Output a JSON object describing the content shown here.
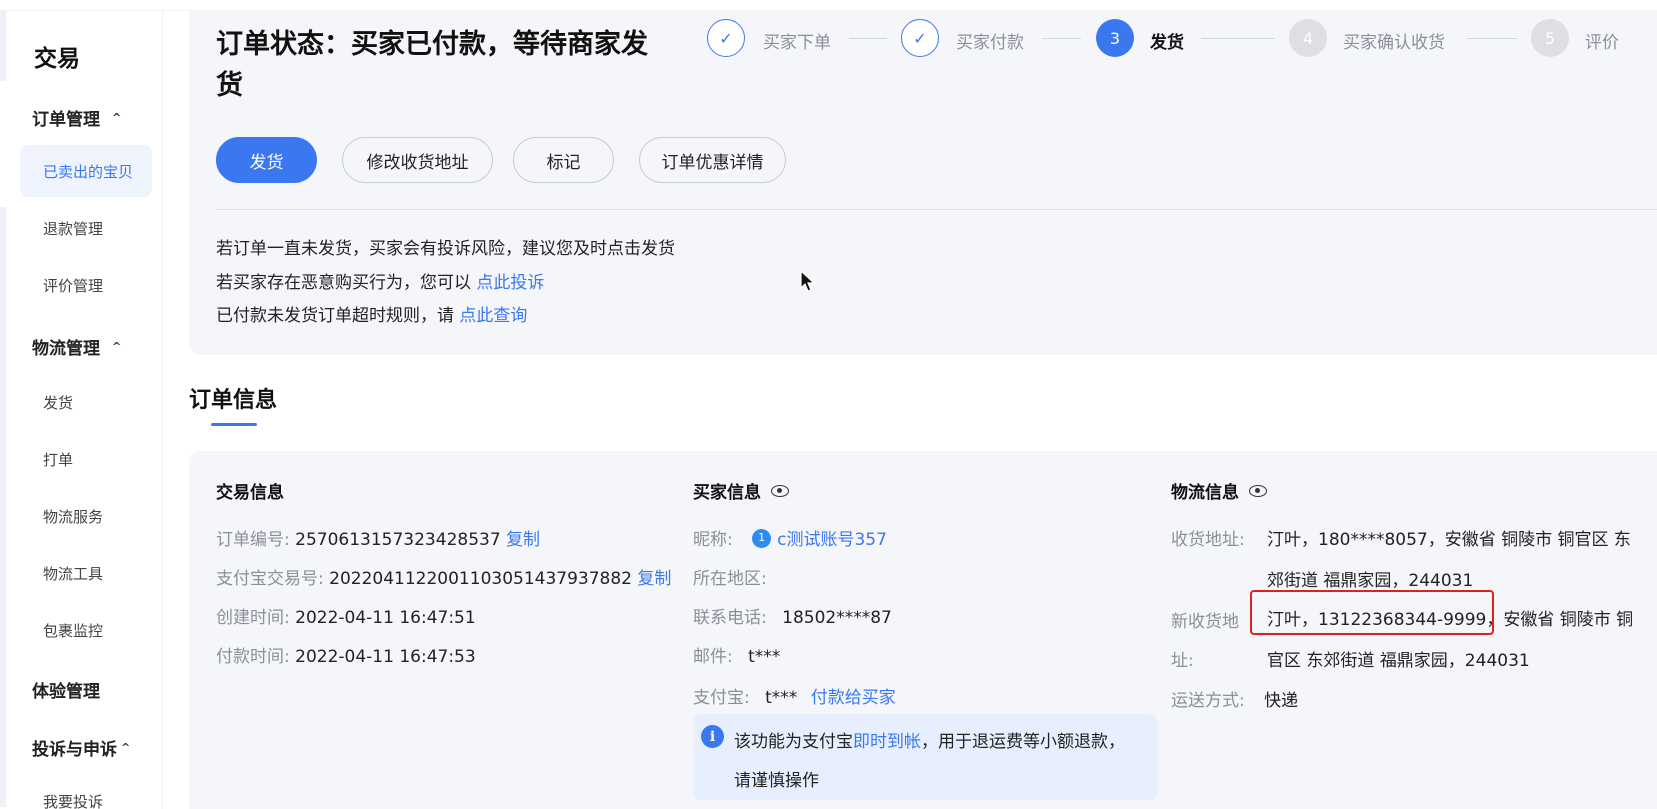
{
  "sidebar": {
    "title": "交易",
    "groups": {
      "order_mgmt": "订单管理",
      "logistics_mgmt": "物流管理",
      "experience_mgmt": "体验管理",
      "complaint": "投诉与申诉"
    },
    "items": {
      "sold_items": "已卖出的宝贝",
      "refund_mgmt": "退款管理",
      "review_mgmt": "评价管理",
      "ship": "发货",
      "print": "打单",
      "logistics_service": "物流服务",
      "logistics_tools": "物流工具",
      "package_monitor": "包裹监控",
      "my_complaint": "我要投诉"
    },
    "chevron": "^"
  },
  "status": {
    "title": "订单状态：买家已付款，等待商家发货",
    "steps": [
      {
        "mark": "✓",
        "label": "买家下单",
        "state": "done"
      },
      {
        "mark": "✓",
        "label": "买家付款",
        "state": "done"
      },
      {
        "mark": "3",
        "label": "发货",
        "state": "current"
      },
      {
        "mark": "4",
        "label": "买家确认收货",
        "state": "todo"
      },
      {
        "mark": "5",
        "label": "评价",
        "state": "todo"
      }
    ],
    "buttons": {
      "ship": "发货",
      "edit_address": "修改收货地址",
      "mark": "标记",
      "discount_detail": "订单优惠详情"
    },
    "notices": {
      "line1": "若订单一直未发货，买家会有投诉风险，建议您及时点击发货",
      "line2_prefix": "若买家存在恶意购买行为，您可以 ",
      "line2_link": "点此投诉",
      "line3_prefix": "已付款未发货订单超时规则，请 ",
      "line3_link": "点此查询"
    }
  },
  "order_info": {
    "section_title": "订单信息",
    "trade": {
      "title": "交易信息",
      "order_no_label": "订单编号: ",
      "order_no": "2570613157323428537",
      "copy": "复制",
      "alipay_no_label": "支付宝交易号: ",
      "alipay_no": "2022041122001103051437937882",
      "created_label": "创建时间: ",
      "created": "2022-04-11 16:47:51",
      "paid_label": "付款时间: ",
      "paid": "2022-04-11 16:47:53"
    },
    "buyer": {
      "title": "买家信息",
      "nickname_label": "昵称:",
      "nickname": "c测试账号357",
      "region_label": "所在地区:",
      "phone_label": "联系电话:",
      "phone": "18502****87",
      "email_label": "邮件:",
      "email": "t***",
      "alipay_label": "支付宝:",
      "alipay": "t***",
      "pay_buyer_link": "付款给买家",
      "tip_prefix": "该功能为支付宝",
      "tip_link": "即时到帐",
      "tip_suffix": "，用于退运费等小额退款，",
      "tip_line2": "请谨慎操作"
    },
    "logistics": {
      "title": "物流信息",
      "address_label": "收货地址:",
      "address_line1": "汀叶，180****8057，安徽省 铜陵市 铜官区 东",
      "address_line2": "郊街道 福鼎家园，244031",
      "new_address_label_1": "新收货地",
      "new_address_label_2": "址:",
      "new_address_highlight": "汀叶，13122368344-9999",
      "new_address_rest": "，安徽省 铜陵市 铜",
      "new_address_line2": "官区 东郊街道 福鼎家园，244031",
      "shipping_label": "运送方式:",
      "shipping": "快递"
    }
  },
  "colors": {
    "accent": "#3b78f0",
    "highlight_border": "#e02020",
    "card_bg": "#f5f6fa"
  }
}
